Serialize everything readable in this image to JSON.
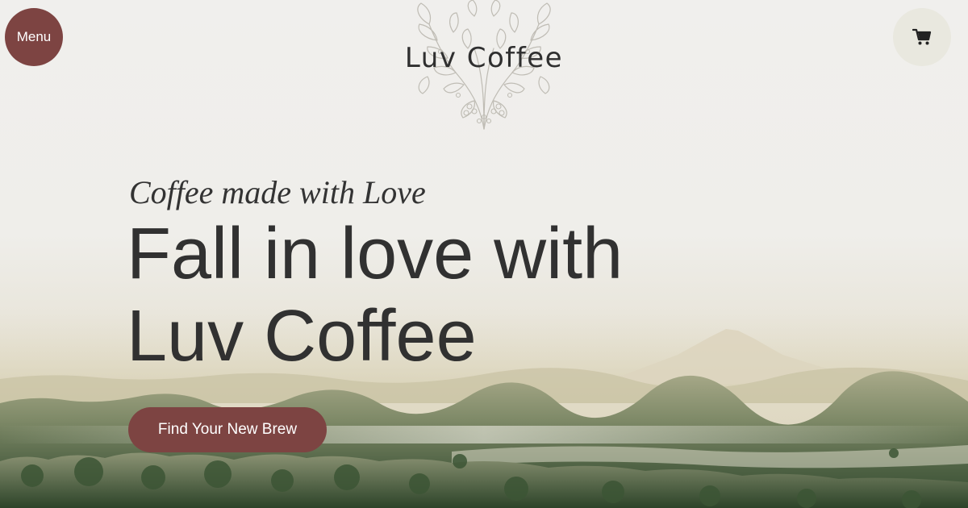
{
  "header": {
    "menu_label": "Menu",
    "brand_name": "Luv Coffee",
    "logo_icon": "coffee-branch-illustration",
    "cart_icon": "shopping-cart-icon"
  },
  "hero": {
    "tagline": "Coffee made with Love",
    "headline_line1": "Fall in love with",
    "headline_line2": "Luv Coffee",
    "cta_label": "Find Your New Brew"
  },
  "colors": {
    "accent": "#7d4442",
    "text": "#313131",
    "background": "#f0efed",
    "cart_bg": "#e9e8df"
  }
}
